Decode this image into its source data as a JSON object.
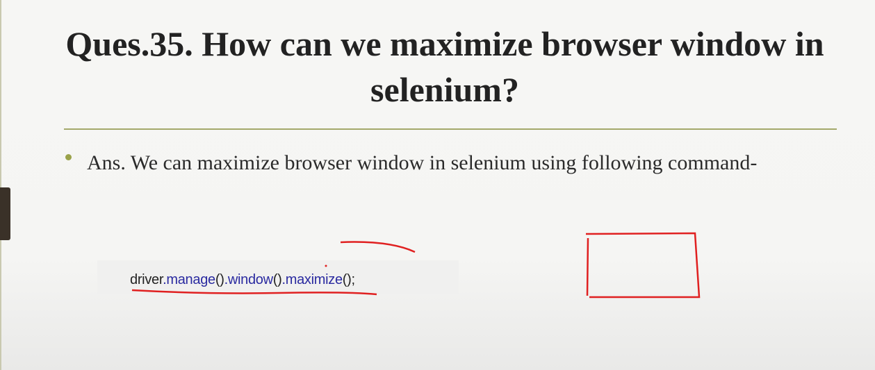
{
  "slide": {
    "title": "Ques.35. How can we maximize browser window in selenium?",
    "answer": "Ans. We can maximize browser window in selenium using following command-",
    "code": {
      "tokens": [
        {
          "text": "driver",
          "kind": "plain"
        },
        {
          "text": ".manage",
          "kind": "method"
        },
        {
          "text": "()",
          "kind": "plain"
        },
        {
          "text": ".window",
          "kind": "method"
        },
        {
          "text": "()",
          "kind": "plain"
        },
        {
          "text": ".maximize",
          "kind": "method"
        },
        {
          "text": "();",
          "kind": "plain"
        }
      ]
    }
  },
  "colors": {
    "accent_rule": "#a4a86a",
    "bullet": "#9aa24a",
    "method": "#2a2aa0",
    "annotation": "#e02020"
  }
}
